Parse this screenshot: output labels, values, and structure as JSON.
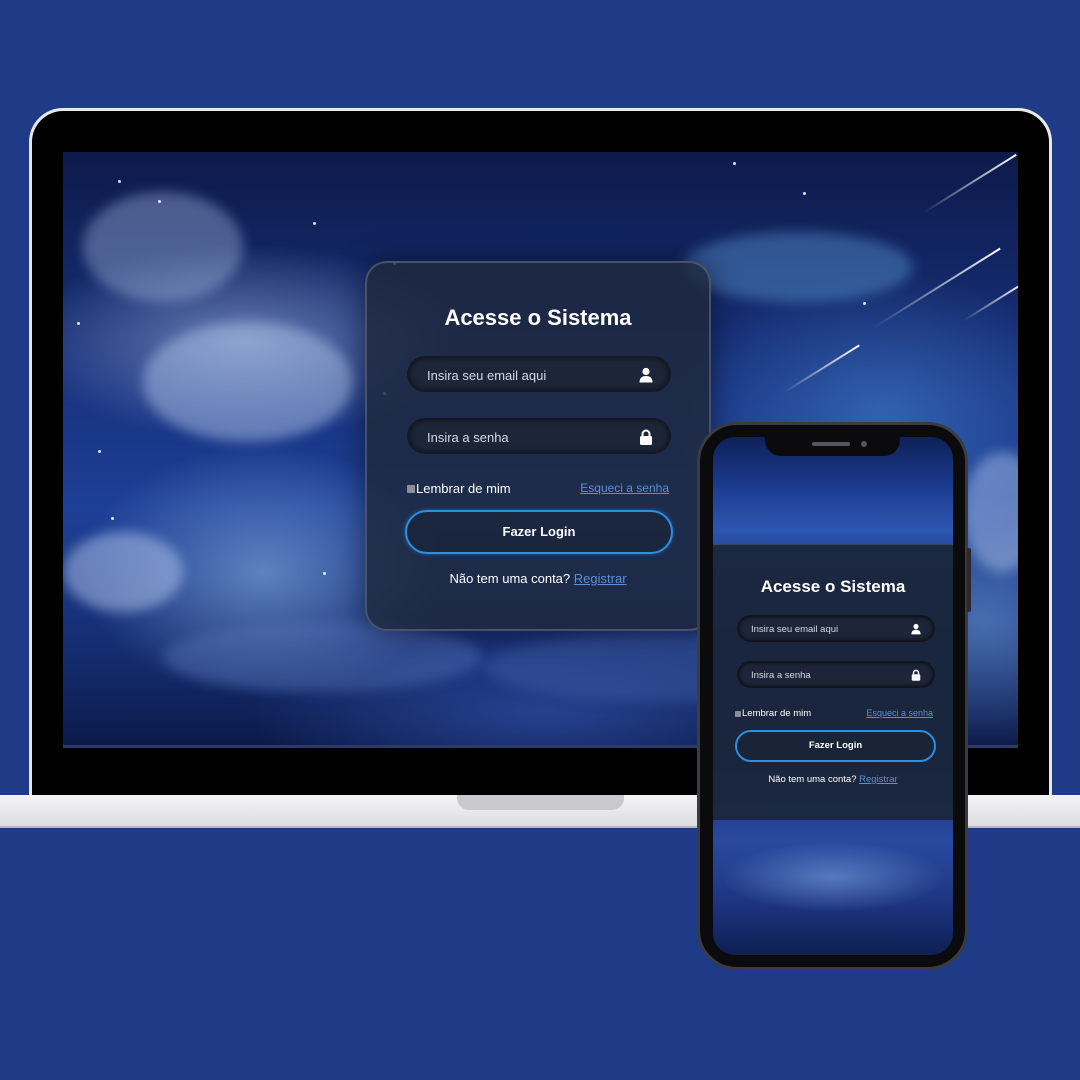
{
  "theme": {
    "page_background": "#1f3b87",
    "accent": "#2c8fe0",
    "link": "#5d8fd6"
  },
  "desktop_login": {
    "title": "Acesse o Sistema",
    "email_placeholder": "Insira seu email aqui",
    "email_icon": "user-icon",
    "password_placeholder": "Insira a senha",
    "password_icon": "lock-icon",
    "remember_label": "Lembrar de mim",
    "forgot_link": "Esqueci a senha",
    "login_button": "Fazer Login",
    "signup_prompt": "Não tem uma conta?",
    "signup_link": "Registrar"
  },
  "mobile_login": {
    "title": "Acesse o Sistema",
    "email_placeholder": "Insira seu email aqui",
    "email_icon": "user-icon",
    "password_placeholder": "Insira a senha",
    "password_icon": "lock-icon",
    "remember_label": "Lembrar de mim",
    "forgot_link": "Esqueci a senha",
    "login_button": "Fazer Login",
    "signup_prompt": "Não tem uma conta?",
    "signup_link": "Registrar"
  }
}
